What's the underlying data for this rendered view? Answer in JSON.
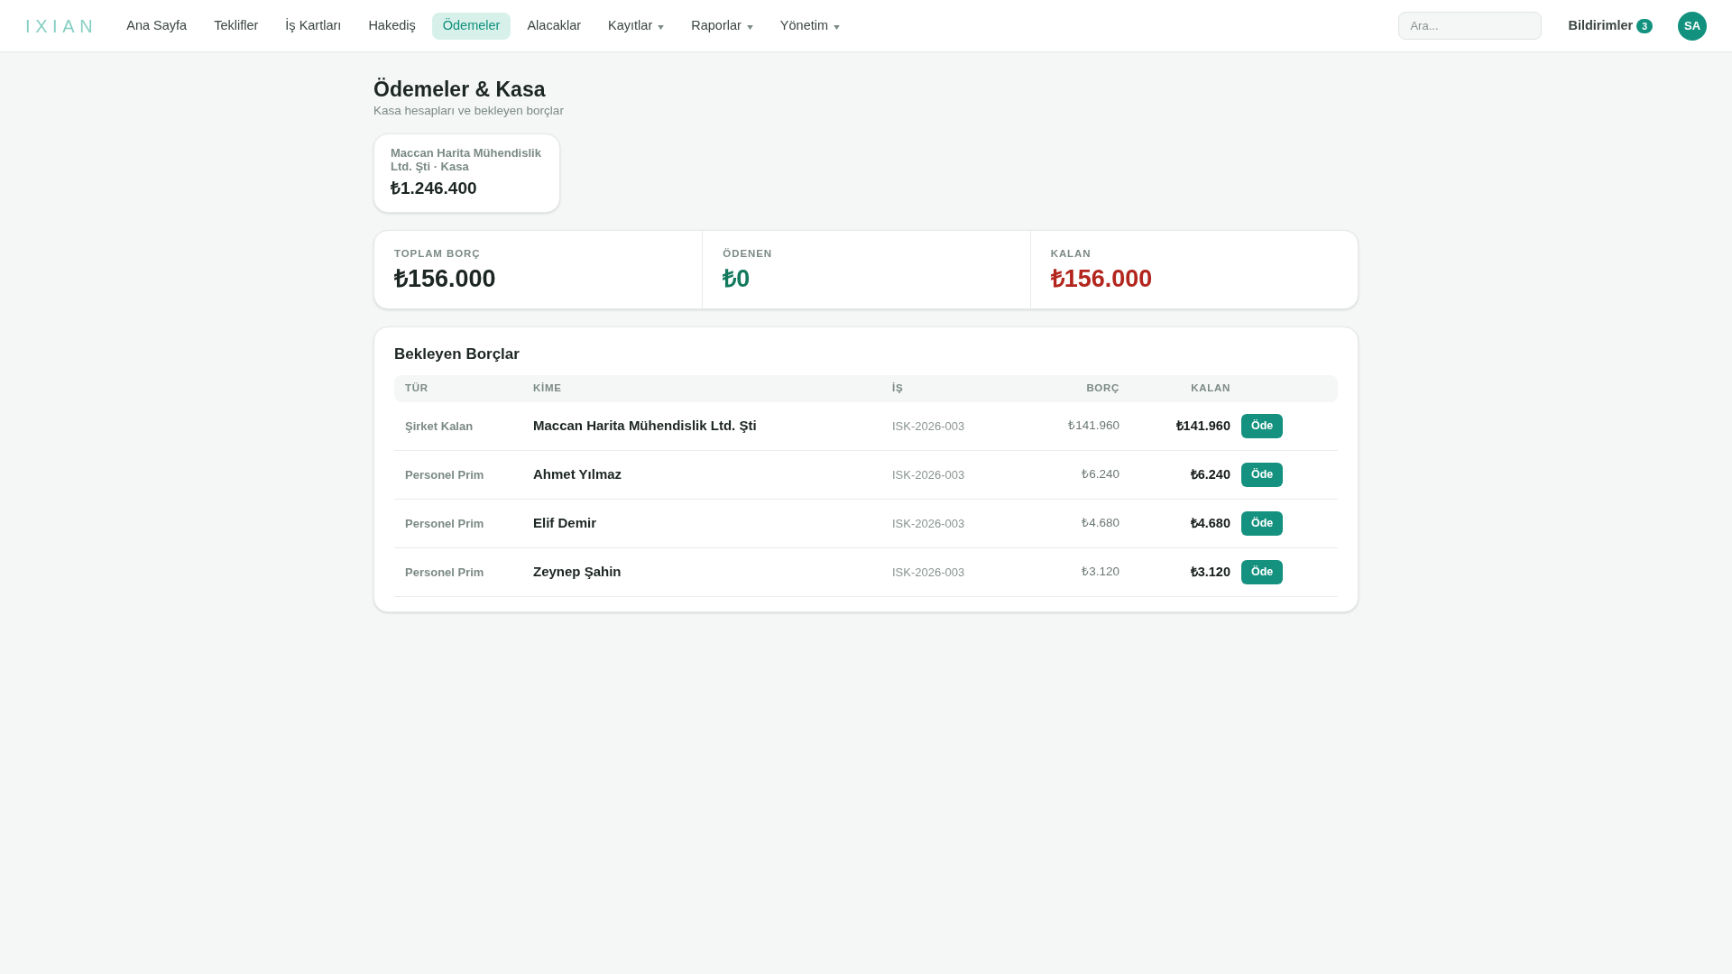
{
  "nav": {
    "logo": "IXIAN",
    "items": [
      {
        "label": "Ana Sayfa",
        "selected": false,
        "has_menu": false
      },
      {
        "label": "Teklifler",
        "selected": false,
        "has_menu": false
      },
      {
        "label": "İş Kartları",
        "selected": false,
        "has_menu": false
      },
      {
        "label": "Hakediş",
        "selected": false,
        "has_menu": false
      },
      {
        "label": "Ödemeler",
        "selected": true,
        "has_menu": false
      },
      {
        "label": "Alacaklar",
        "selected": false,
        "has_menu": false
      },
      {
        "label": "Kayıtlar",
        "selected": false,
        "has_menu": true
      },
      {
        "label": "Raporlar",
        "selected": false,
        "has_menu": true
      },
      {
        "label": "Yönetim",
        "selected": false,
        "has_menu": true
      }
    ],
    "search": {
      "placeholder": "Ara..."
    },
    "notifications": {
      "label": "Bildirimler",
      "count": "3"
    },
    "avatar": {
      "initials": "SA"
    }
  },
  "page": {
    "title": "Ödemeler & Kasa",
    "subtitle": "Kasa hesapları ve bekleyen borçlar"
  },
  "cash_accounts": [
    {
      "name": "Maccan Harita Mühendislik Ltd. Şti · Kasa",
      "balance": "₺1.246.400"
    }
  ],
  "summary": [
    {
      "kind": "total",
      "label": "TOPLAM BORÇ",
      "value": "₺156.000"
    },
    {
      "kind": "paid",
      "label": "ÖDENEN",
      "value": "₺0"
    },
    {
      "kind": "remaining",
      "label": "KALAN",
      "value": "₺156.000"
    }
  ],
  "pending": {
    "title": "Bekleyen Borçlar",
    "columns": [
      "TÜR",
      "KİME",
      "İŞ",
      "BORÇ",
      "KALAN"
    ],
    "rows": [
      {
        "type": "Şirket Kalan",
        "to": "Maccan Harita Mühendislik Ltd. Şti",
        "job": "ISK-2026-003",
        "debt": "₺141.960",
        "remaining": "₺141.960",
        "action": "Öde"
      },
      {
        "type": "Personel Prim",
        "to": "Ahmet Yılmaz",
        "job": "ISK-2026-003",
        "debt": "₺6.240",
        "remaining": "₺6.240",
        "action": "Öde"
      },
      {
        "type": "Personel Prim",
        "to": "Elif Demir",
        "job": "ISK-2026-003",
        "debt": "₺4.680",
        "remaining": "₺4.680",
        "action": "Öde"
      },
      {
        "type": "Personel Prim",
        "to": "Zeynep Şahin",
        "job": "ISK-2026-003",
        "debt": "₺3.120",
        "remaining": "₺3.120",
        "action": "Öde"
      }
    ]
  }
}
